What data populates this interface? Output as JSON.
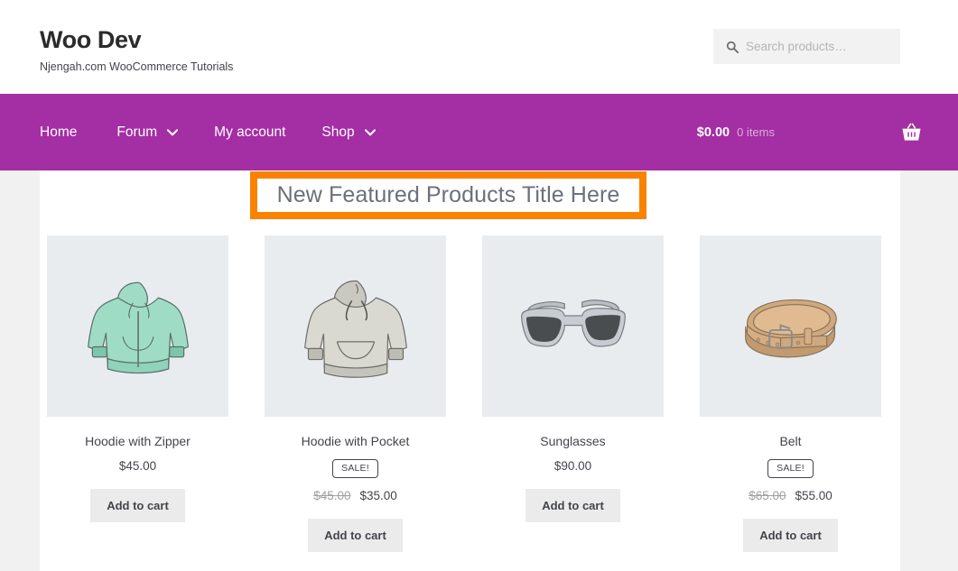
{
  "header": {
    "site_title": "Woo Dev",
    "tagline": "Njengah.com WooCommerce Tutorials",
    "search": {
      "placeholder": "Search products…",
      "value": "",
      "icon": "search-icon"
    }
  },
  "nav": {
    "background_color": "#a42ea4",
    "items": [
      {
        "label": "Home",
        "has_dropdown": false
      },
      {
        "label": "Forum",
        "has_dropdown": true
      },
      {
        "label": "My account",
        "has_dropdown": false
      },
      {
        "label": "Shop",
        "has_dropdown": true
      }
    ],
    "cart": {
      "amount": "$0.00",
      "count": "0 items",
      "icon": "shopping-basket-icon"
    }
  },
  "main": {
    "featured_title": "New Featured Products Title Here",
    "highlight_color": "#f98300",
    "products": [
      {
        "title": "Hoodie with Zipper",
        "on_sale": false,
        "sale_label": "",
        "regular_price": "",
        "price": "$45.00",
        "button_label": "Add to cart",
        "image": "zip-hoodie-mint-illustration"
      },
      {
        "title": "Hoodie with Pocket",
        "on_sale": true,
        "sale_label": "SALE!",
        "regular_price": "$45.00",
        "price": "$35.00",
        "button_label": "Add to cart",
        "image": "pullover-hoodie-gray-illustration"
      },
      {
        "title": "Sunglasses",
        "on_sale": false,
        "sale_label": "",
        "regular_price": "",
        "price": "$90.00",
        "button_label": "Add to cart",
        "image": "sunglasses-gray-illustration"
      },
      {
        "title": "Belt",
        "on_sale": true,
        "sale_label": "SALE!",
        "regular_price": "$65.00",
        "price": "$55.00",
        "button_label": "Add to cart",
        "image": "leather-belt-tan-illustration"
      }
    ]
  }
}
